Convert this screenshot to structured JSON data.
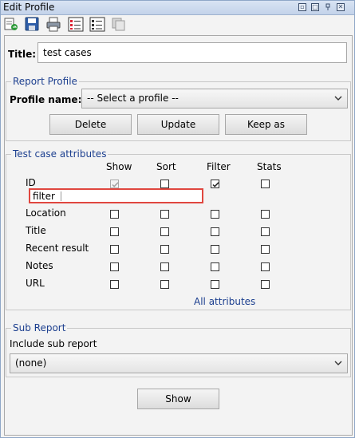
{
  "window": {
    "title": "Edit Profile"
  },
  "toolbar": {
    "icons": [
      "open-profile-icon",
      "save-icon",
      "print-icon",
      "checklist-icon",
      "list-icon",
      "copy-icon"
    ]
  },
  "form": {
    "title_label": "Title:",
    "title_value": "test cases"
  },
  "report_profile": {
    "legend": "Report Profile",
    "profile_name_label": "Profile name:",
    "profile_selected": "-- Select a profile --",
    "delete_label": "Delete",
    "update_label": "Update",
    "keep_as_label": "Keep as"
  },
  "attributes": {
    "legend": "Test case attributes",
    "columns": [
      "Show",
      "Sort",
      "Filter",
      "Stats"
    ],
    "rows": [
      {
        "label": "ID",
        "show": true,
        "show_disabled": true,
        "sort": false,
        "filter": true,
        "stats": false
      },
      {
        "label": "Location",
        "show": false,
        "sort": false,
        "filter": false,
        "stats": false
      },
      {
        "label": "Title",
        "show": false,
        "sort": false,
        "filter": false,
        "stats": false
      },
      {
        "label": "Recent result",
        "show": false,
        "sort": false,
        "filter": false,
        "stats": false
      },
      {
        "label": "Notes",
        "show": false,
        "sort": false,
        "filter": false,
        "stats": false
      },
      {
        "label": "URL",
        "show": false,
        "sort": false,
        "filter": false,
        "stats": false
      }
    ],
    "filter_input_value": "filter",
    "all_attributes_link": "All attributes"
  },
  "sub_report": {
    "legend": "Sub Report",
    "include_label": "Include sub report",
    "selected": "(none)"
  },
  "show_button_label": "Show",
  "colors": {
    "accent": "#1c3f8f",
    "highlight_border": "#e0473f"
  }
}
